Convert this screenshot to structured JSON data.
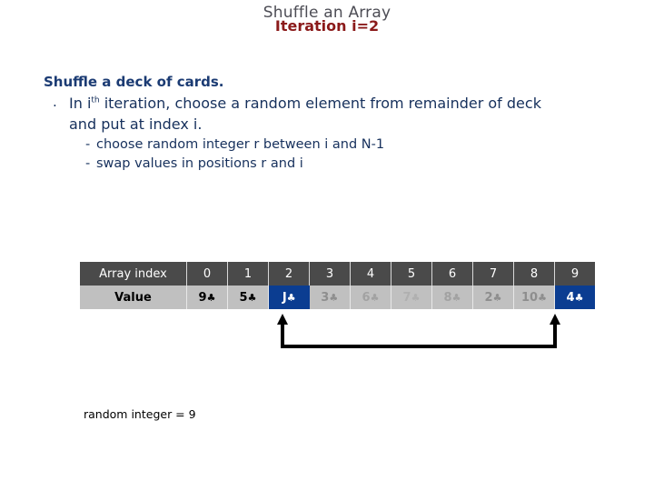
{
  "slide": {
    "title": "Shuffle an Array",
    "subtitle": "Iteration i=2"
  },
  "body": {
    "heading": "Shuffle a deck of cards.",
    "bullet_marker": ".",
    "bullet_line1_a": "In i",
    "bullet_line1_sup": "th",
    "bullet_line1_b": " iteration, choose a random element from remainder of deck",
    "bullet_line2": "and put at index i.",
    "sub_bullet1": "choose random integer r between i and N-1",
    "sub_bullet2": "swap values in positions r and i",
    "dash": "-"
  },
  "table": {
    "row1_label": "Array index",
    "row2_label": "Value",
    "indices": [
      "0",
      "1",
      "2",
      "3",
      "4",
      "5",
      "6",
      "7",
      "8",
      "9"
    ],
    "values": [
      {
        "rank": "9",
        "suit": "♣",
        "state": "normal"
      },
      {
        "rank": "5",
        "suit": "♣",
        "state": "normal"
      },
      {
        "rank": "J",
        "suit": "♣",
        "state": "selected"
      },
      {
        "rank": "3",
        "suit": "♣",
        "state": "dim1"
      },
      {
        "rank": "6",
        "suit": "♣",
        "state": "dim2"
      },
      {
        "rank": "7",
        "suit": "♣",
        "state": "dim3"
      },
      {
        "rank": "8",
        "suit": "♣",
        "state": "dim2"
      },
      {
        "rank": "2",
        "suit": "♣",
        "state": "dim1"
      },
      {
        "rank": "10",
        "suit": "♣",
        "state": "dim1"
      },
      {
        "rank": "4",
        "suit": "♣",
        "state": "selected"
      }
    ]
  },
  "footer": {
    "random_integer_note": "random integer = 9"
  },
  "colors": {
    "title": "#4d4d55",
    "subtitle": "#8b1a1a",
    "body_text": "#16305c",
    "header_row_bg": "#4a4a4a",
    "value_row_bg": "#c0c0c0",
    "selected_cell_bg": "#0b3d91",
    "arrow": "#000000"
  }
}
